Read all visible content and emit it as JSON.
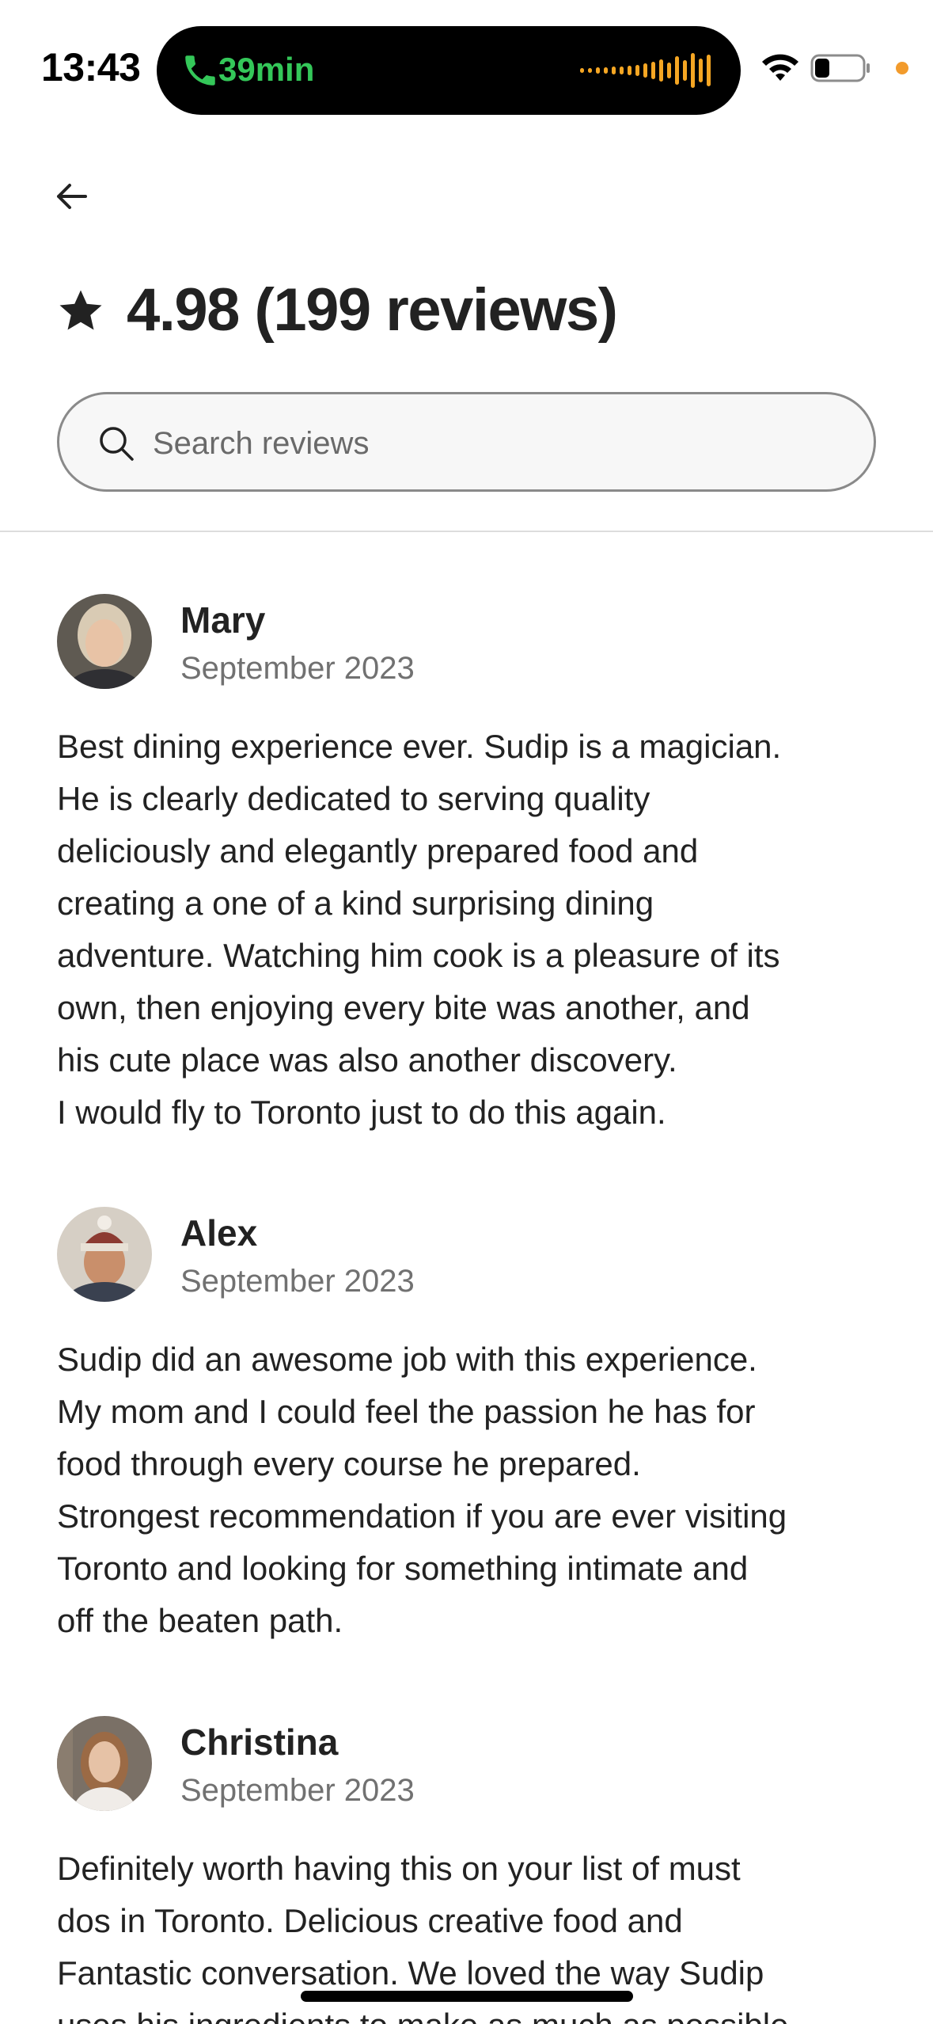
{
  "status_bar": {
    "time": "13:43",
    "call_duration": "39min",
    "call_color": "#34c759",
    "waveform_color": "#f5a623",
    "battery_level": 0.25
  },
  "nav": {
    "back_icon": "arrow-left-icon"
  },
  "header": {
    "rating": "4.98 (199 reviews)",
    "icon": "star-icon"
  },
  "search": {
    "placeholder": "Search reviews",
    "icon": "search-icon"
  },
  "reviews": [
    {
      "name": "Mary",
      "date": "September 2023",
      "text": "Best dining experience ever. Sudip is a magician.\nHe is clearly dedicated to serving quality\ndeliciously and elegantly prepared food and\ncreating a one of a kind surprising dining\nadventure. Watching him cook is a pleasure of its\nown, then enjoying every bite was another, and\nhis cute place was also another discovery.\nI would fly to Toronto just to do this again."
    },
    {
      "name": "Alex",
      "date": "September 2023",
      "text": "Sudip did an awesome job with this experience.\nMy mom and I could feel the passion he has for\nfood through every course he prepared.\nStrongest recommendation if you are ever visiting\nToronto and looking for something intimate and\noff the beaten path."
    },
    {
      "name": "Christina",
      "date": "September 2023",
      "text": "Definitely worth having this on your list of must\ndos in Toronto. Delicious creative food and\nFantastic conversation. We loved the way Sudip\nuses his ingredients to make as much as possible"
    }
  ]
}
